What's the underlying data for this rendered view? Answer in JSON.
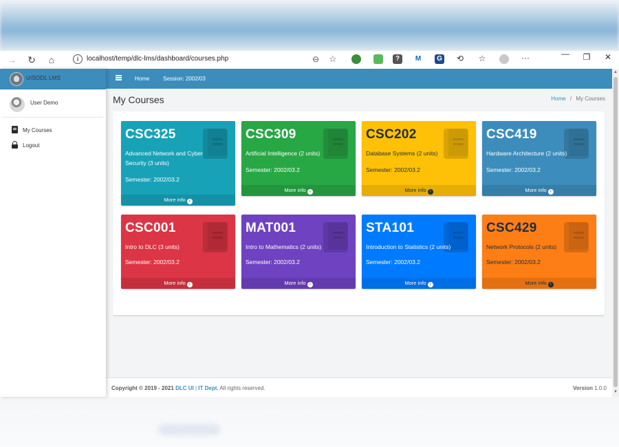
{
  "browser": {
    "url": "localhost/temp/dlc-lms/dashboard/courses.php"
  },
  "app": {
    "brand": "UISODL LMS",
    "user_name": "User Demo",
    "sidebar_items": [
      {
        "label": "My Courses",
        "icon": "book-icon"
      },
      {
        "label": "Logout",
        "icon": "lock-icon"
      }
    ],
    "topnav": {
      "home": "Home",
      "session": "Session: 2002/03"
    }
  },
  "page": {
    "title": "My Courses",
    "breadcrumb": {
      "home": "Home",
      "separator": "/",
      "current": "My Courses"
    }
  },
  "courses": [
    {
      "code": "CSC325",
      "title": "Advanced Network and Cyber Security (3 units)",
      "semester": "Semester: 2002/03.2",
      "more": "More info",
      "color": "#17a2b8"
    },
    {
      "code": "CSC309",
      "title": "Artificial Intelligence (2 units)",
      "semester": "Semester: 2002/03.2",
      "more": "More info",
      "color": "#28a745"
    },
    {
      "code": "CSC202",
      "title": "Database Systems (2 units)",
      "semester": "Semester: 2002/03.2",
      "more": "More info",
      "color": "#ffc107"
    },
    {
      "code": "CSC419",
      "title": "Hardware Architecture (2 units)",
      "semester": "Semester: 2002/03.2",
      "more": "More info",
      "color": "#3c8dbc"
    },
    {
      "code": "CSC001",
      "title": "Intro to DLC (3 units)",
      "semester": "Semester: 2002/03.2",
      "more": "More info",
      "color": "#dc3545"
    },
    {
      "code": "MAT001",
      "title": "Intro to Mathematics (2 units)",
      "semester": "Semester: 2002/03.2",
      "more": "More info",
      "color": "#6f42c1"
    },
    {
      "code": "STA101",
      "title": "Introduction to Statistics (2 units)",
      "semester": "Semester: 2002/03.2",
      "more": "More info",
      "color": "#007bff"
    },
    {
      "code": "CSC429",
      "title": "Network Protocols (2 units)",
      "semester": "Semester: 2002/03.2",
      "more": "More info",
      "color": "#fd7e14"
    }
  ],
  "footer": {
    "copyright": "Copyright © 2019 - 2021",
    "org1": "DLC UI",
    "sep": "|",
    "org2": "IT Dept.",
    "rights": "All rights reserved.",
    "version_label": "Version",
    "version": "1.0.0"
  }
}
